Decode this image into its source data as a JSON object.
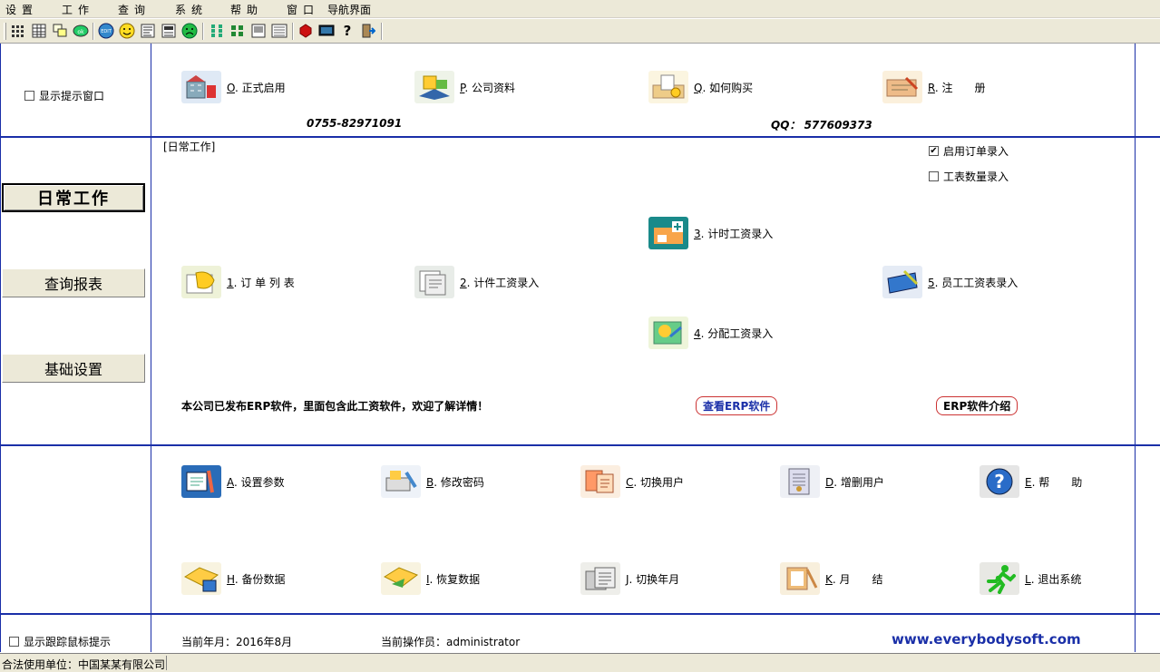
{
  "menu": [
    {
      "label": "设置"
    },
    {
      "label": "工作"
    },
    {
      "label": "查询"
    },
    {
      "label": "系统"
    },
    {
      "label": "帮助"
    },
    {
      "label": "窗口"
    },
    {
      "label": "导航界面"
    }
  ],
  "toolbar_icons": [
    "grid-icon",
    "table-icon",
    "windows-icon",
    "disk-icon",
    "edit-icon",
    "smile-icon",
    "form-icon",
    "list-icon",
    "sad-icon",
    "hierarchy-icon",
    "tiles-icon",
    "report-icon",
    "printer-icon",
    "stop-icon",
    "screen-icon",
    "help-icon",
    "exit-icon"
  ],
  "top_panel": {
    "show_tip_window": "显示提示窗口",
    "items": [
      {
        "key": "O",
        "label": ". 正式启用"
      },
      {
        "key": "P",
        "label": ". 公司资料"
      },
      {
        "key": "Q",
        "label": ". 如何购买"
      },
      {
        "key": "R",
        "label": ". 注　　册"
      }
    ],
    "phone": "0755-82971091",
    "qq": "QQ：  577609373"
  },
  "nav": {
    "daily_work": "日常工作",
    "query_report": "查询报表",
    "basic_settings": "基础设置"
  },
  "work_panel": {
    "section_title": "[日常工作]",
    "enable_order_entry": "启用订单录入",
    "enable_order_entry_checked": true,
    "worksheet_qty_entry": "工表数量录入",
    "worksheet_qty_entry_checked": false,
    "items": [
      {
        "key": "1",
        "label": ". 订 单 列 表"
      },
      {
        "key": "2",
        "label": ". 计件工资录入"
      },
      {
        "key": "3",
        "label": ". 计时工资录入"
      },
      {
        "key": "4",
        "label": ". 分配工资录入"
      },
      {
        "key": "5",
        "label": ". 员工工资表录入"
      }
    ],
    "erp_notice": "本公司已发布ERP软件，里面包含此工资软件，欢迎了解详情！",
    "view_erp": "查看ERP软件",
    "erp_intro": "ERP软件介绍"
  },
  "system_panel": {
    "row1": [
      {
        "key": "A",
        "label": ". 设置参数"
      },
      {
        "key": "B",
        "label": ". 修改密码"
      },
      {
        "key": "C",
        "label": ". 切换用户"
      },
      {
        "key": "D",
        "label": ". 增删用户"
      },
      {
        "key": "E",
        "label": ". 帮　　助"
      }
    ],
    "row2": [
      {
        "key": "H",
        "label": ". 备份数据"
      },
      {
        "key": "I",
        "label": ". 恢复数据"
      },
      {
        "key": "J",
        "label": ". 切换年月"
      },
      {
        "key": "K",
        "label": ". 月　　结"
      },
      {
        "key": "L",
        "label": ". 退出系统"
      }
    ]
  },
  "footer_panel": {
    "show_mouse_tip": "显示跟踪鼠标提示",
    "current_period": "当前年月：2016年8月",
    "current_operator": "当前操作员：administrator",
    "website": "www.everybodysoft.com"
  },
  "statusbar": {
    "licensed_to": "合法使用单位：中国某某有限公司"
  },
  "colors": {
    "frame_line": "#1a2fa8",
    "website": "#1a2fa8",
    "chrome": "#ece9d8"
  }
}
